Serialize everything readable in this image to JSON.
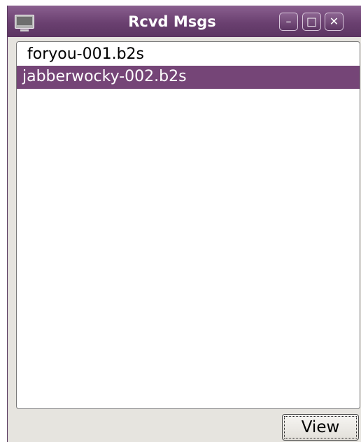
{
  "window": {
    "title": "Rcvd Msgs",
    "icons": {
      "app": "monitor-icon",
      "minimize": "minimize-icon",
      "maximize": "maximize-icon",
      "close": "close-icon"
    },
    "controls": {
      "minimize_glyph": "–",
      "maximize_glyph": "□",
      "close_glyph": "✕"
    },
    "colors": {
      "titlebar": "#6a4070",
      "selection": "#754577"
    }
  },
  "list": {
    "items": [
      {
        "label": "foryou-001.b2s",
        "selected": false
      },
      {
        "label": "jabberwocky-002.b2s",
        "selected": true
      }
    ]
  },
  "buttons": {
    "view_label": "View"
  }
}
